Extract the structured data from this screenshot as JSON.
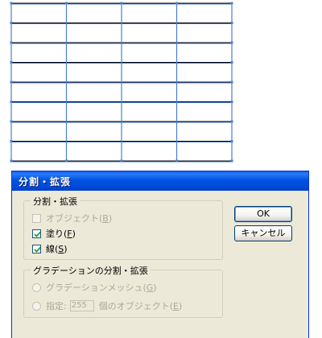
{
  "dialog": {
    "title": "分割・拡張",
    "expand_group": {
      "legend": "分割・拡張",
      "object": {
        "label": "オブジェクト",
        "key": "B",
        "checked": false,
        "enabled": false
      },
      "fill": {
        "label": "塗り",
        "key": "F",
        "checked": true,
        "enabled": true
      },
      "stroke": {
        "label": "線",
        "key": "S",
        "checked": true,
        "enabled": true
      }
    },
    "gradient_group": {
      "legend": "グラデーションの分割・拡張",
      "mesh_option": {
        "label": "グラデーションメッシュ",
        "key": "G"
      },
      "specify_option": {
        "label": "指定:",
        "value": "255",
        "suffix": "個のオブジェクト",
        "key": "E"
      }
    },
    "buttons": {
      "ok": "OK",
      "cancel": "キャンセル"
    }
  },
  "artwork": {
    "columns": 4,
    "rows": 8,
    "stroke_color": "#000000",
    "selection_color": "#4a7fd6"
  }
}
